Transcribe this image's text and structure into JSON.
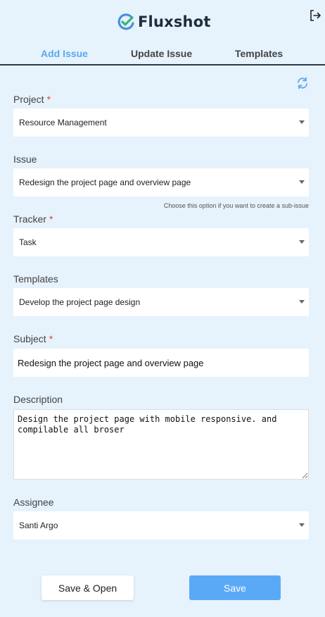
{
  "app": {
    "name": "Fluxshot"
  },
  "tabs": [
    {
      "label": "Add Issue",
      "active": true
    },
    {
      "label": "Update Issue",
      "active": false
    },
    {
      "label": "Templates",
      "active": false
    }
  ],
  "form": {
    "project": {
      "label": "Project",
      "required_mark": "*",
      "value": "Resource Management"
    },
    "issue": {
      "label": "Issue",
      "value": "Redesign the project page and overview page",
      "hint": "Choose this option if you want to create a sub-issue"
    },
    "tracker": {
      "label": "Tracker",
      "required_mark": "*",
      "value": "Task"
    },
    "templates": {
      "label": "Templates",
      "value": "Develop the project page design"
    },
    "subject": {
      "label": "Subject",
      "required_mark": "*",
      "value": "Redesign the project page and overview page"
    },
    "description": {
      "label": "Description",
      "value": "Design the project page with mobile responsive. and compilable all broser"
    },
    "assignee": {
      "label": "Assignee",
      "value": "Santi Argo"
    }
  },
  "buttons": {
    "save_open": "Save & Open",
    "save": "Save"
  },
  "colors": {
    "accent": "#5aa9ee",
    "background": "#e6f2fc",
    "required": "#e0453a",
    "logo_green": "#2fb87a",
    "logo_blue": "#4a90d9"
  },
  "icons": {
    "logout": "logout-icon",
    "refresh": "refresh-icon",
    "logo": "fluxshot-logo-icon"
  }
}
